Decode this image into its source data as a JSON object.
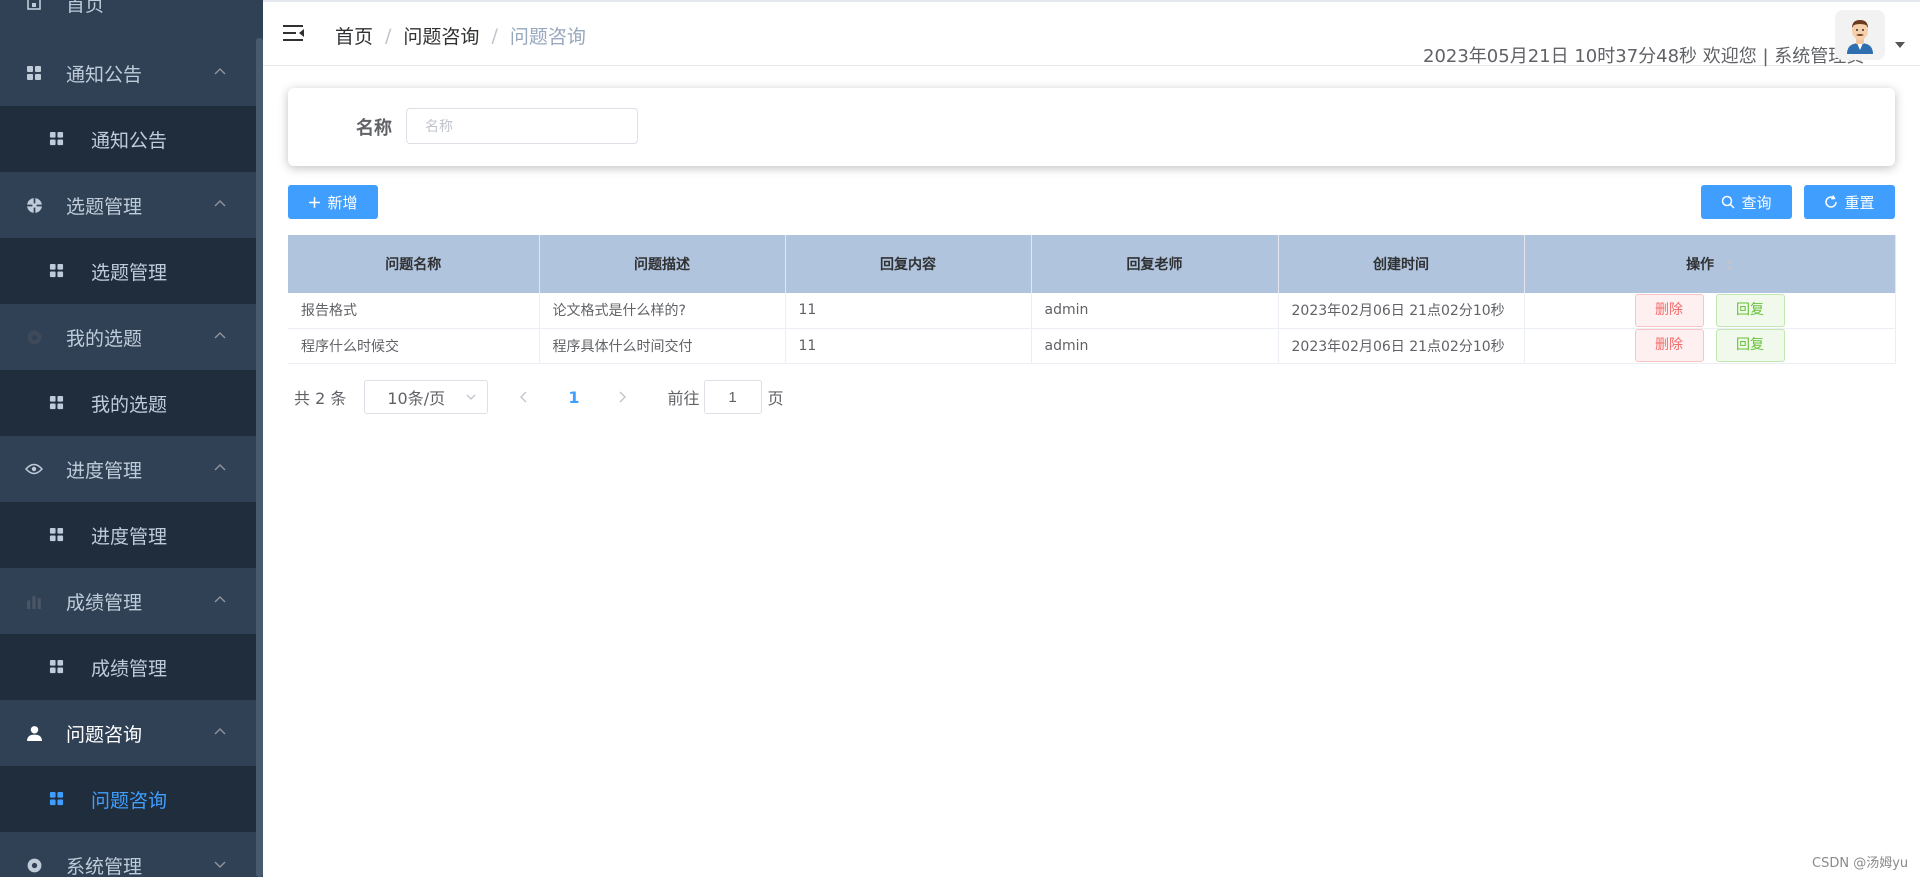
{
  "sidebar": {
    "top_partial_label": "首页",
    "groups": [
      {
        "label": "通知公告",
        "child": "通知公告"
      },
      {
        "label": "选题管理",
        "child": "选题管理"
      },
      {
        "label": "我的选题",
        "child": "我的选题"
      },
      {
        "label": "进度管理",
        "child": "进度管理"
      },
      {
        "label": "成绩管理",
        "child": "成绩管理"
      },
      {
        "label": "问题咨询",
        "child": "问题咨询"
      }
    ],
    "bottom_partial_label": "系统管理",
    "active_child": "问题咨询"
  },
  "header": {
    "breadcrumb": [
      "首页",
      "问题咨询",
      "问题咨询"
    ],
    "info": "2023年05月21日 10时37分48秒 欢迎您 | 系统管理员"
  },
  "search": {
    "label": "名称",
    "placeholder": "名称",
    "value": ""
  },
  "toolbar": {
    "add_label": "新增",
    "query_label": "查询",
    "reset_label": "重置"
  },
  "table": {
    "columns": [
      "问题名称",
      "问题描述",
      "回复内容",
      "回复老师",
      "创建时间",
      "操作"
    ],
    "rows": [
      {
        "name": "报告格式",
        "desc": "论文格式是什么样的?",
        "reply": "11",
        "teacher": "admin",
        "created": "2023年02月06日 21点02分10秒"
      },
      {
        "name": "程序什么时候交",
        "desc": "程序具体什么时间交付",
        "reply": "11",
        "teacher": "admin",
        "created": "2023年02月06日 21点02分10秒"
      }
    ],
    "delete_label": "删除",
    "reply_label": "回复"
  },
  "pagination": {
    "total": "共 2 条",
    "page_size": "10条/页",
    "current_page": "1",
    "goto_label": "前往",
    "jump_value": "1",
    "page_unit": "页"
  },
  "watermark": "CSDN @汤姆yu",
  "colors": {
    "sidebar_bg": "#304156",
    "submenu_bg": "#1f2d3d",
    "primary": "#409eff",
    "table_header": "#b0c4de",
    "danger": "#f56c6c",
    "success": "#67c23a"
  }
}
